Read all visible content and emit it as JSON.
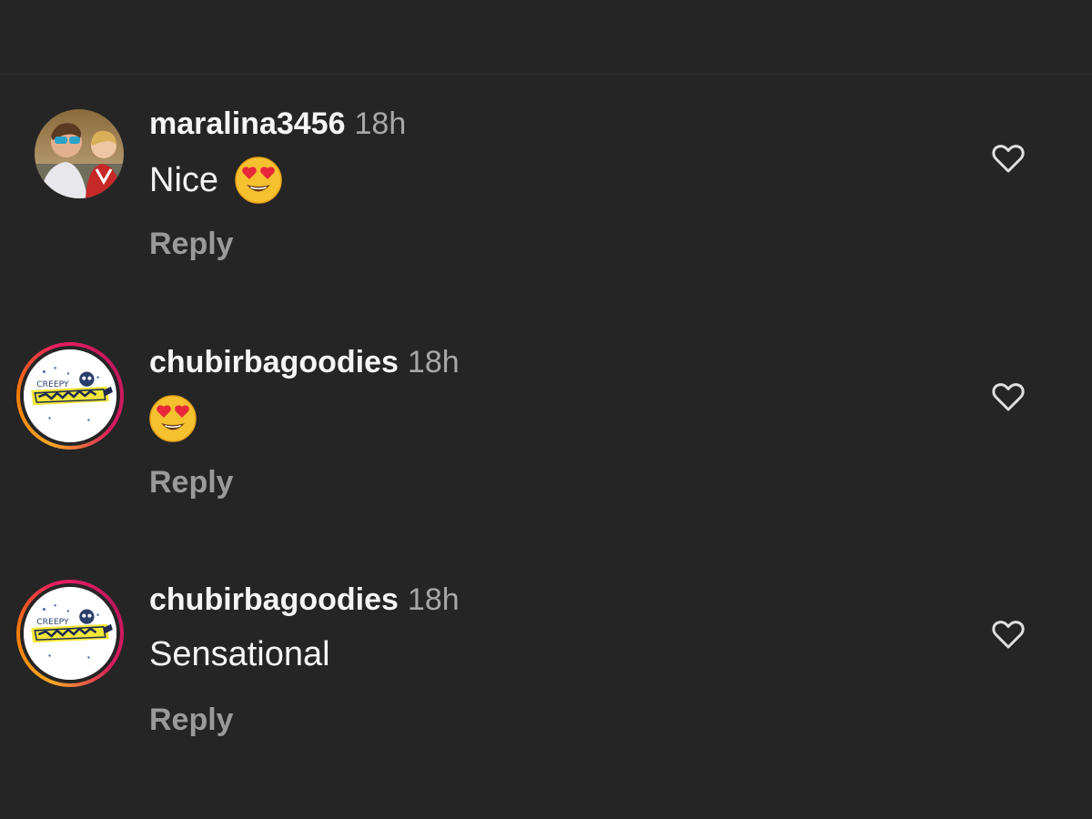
{
  "comments": [
    {
      "username": "maralina3456",
      "time": "18h",
      "text": "Nice",
      "emoji": "heart-eyes-emoji",
      "reply_label": "Reply",
      "avatar": "photo"
    },
    {
      "username": "chubirbagoodies",
      "time": "18h",
      "text": "",
      "emoji": "heart-eyes-emoji",
      "reply_label": "Reply",
      "avatar": "brand-logo-story-ring"
    },
    {
      "username": "chubirbagoodies",
      "time": "18h",
      "text": "Sensational",
      "emoji": "",
      "reply_label": "Reply",
      "avatar": "brand-logo-story-ring"
    }
  ],
  "colors": {
    "background": "#252525",
    "username": "#f5f5f5",
    "timestamp": "#a8a8a8",
    "reply": "#9a9a9a",
    "story_ring_start": "#f9a825",
    "story_ring_end": "#d81b60"
  }
}
